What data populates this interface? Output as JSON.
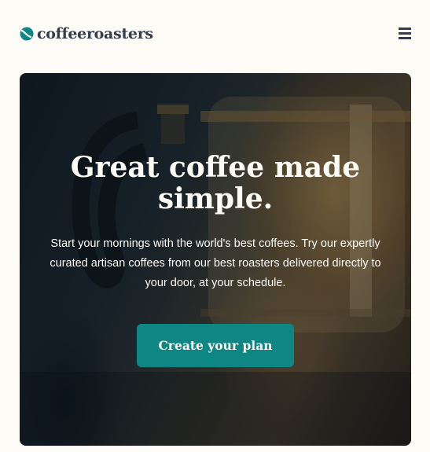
{
  "header": {
    "logo_text": "coffeeroasters",
    "logo_icon": "coffee-bean-icon",
    "menu_icon": "hamburger-menu-icon"
  },
  "hero": {
    "title": "Great coffee made simple.",
    "description": "Start your mornings with the world's best coffees. Try our expertly curated artisan coffees from our best roasters delivered directly to your door, at your schedule.",
    "cta_label": "Create your plan"
  },
  "colors": {
    "background": "#fefcf7",
    "dark_text": "#333d4b",
    "accent": "#0e8784",
    "light_text": "#fefcf7"
  }
}
